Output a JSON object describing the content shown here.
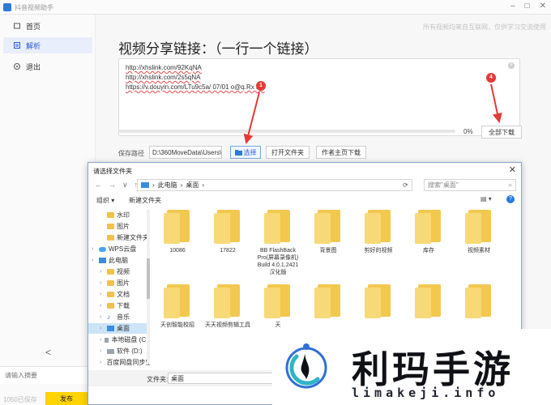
{
  "app": {
    "title": "抖音视频助手",
    "watermark": "所有视频均来自互联网，仅供学习交流使用",
    "heading": "视频分享链接：（一行一个链接）",
    "urls": [
      "http://xhslink.com/92KqNA",
      "http://xhslink.com/2s5qNA",
      "https://v.douyin.com/LTu9c5a/ 07/01 o@q.Rx mk"
    ],
    "progress": {
      "value": 0,
      "label": "0%"
    },
    "download_all": "全部下载",
    "path_label": "保存路径",
    "path_value": "D:\\360MoveData\\Users\\",
    "choose": "选择",
    "open_folder": "打开文件夹",
    "author_page": "作者主页下载"
  },
  "sidebar": {
    "items": [
      {
        "label": "首页",
        "icon": "home-icon"
      },
      {
        "label": "解析",
        "icon": "parse-icon",
        "active": true
      },
      {
        "label": "退出",
        "icon": "exit-icon"
      }
    ],
    "collapse": "<",
    "summary_placeholder": "请输入摘要",
    "counter": "1050已保存",
    "save": "发布"
  },
  "badges": {
    "choose": "1",
    "download": "4"
  },
  "dialog": {
    "title": "请选择文件夹",
    "close": "✕",
    "nav": [
      "←",
      "→",
      "∨",
      "↑"
    ],
    "breadcrumb": [
      "此电脑",
      "桌面"
    ],
    "search_placeholder": "搜索\"桌面\"",
    "organize": "组织 ▾",
    "new_folder": "新建文件夹",
    "tree": [
      {
        "label": "水印",
        "icon": "folder",
        "level": 1
      },
      {
        "label": "图片",
        "icon": "folder",
        "level": 1
      },
      {
        "label": "新建文件夹",
        "icon": "folder",
        "level": 1
      },
      {
        "label": "WPS云盘",
        "icon": "cloud",
        "level": 0
      },
      {
        "label": "此电脑",
        "icon": "pc",
        "level": 0
      },
      {
        "label": "视频",
        "icon": "folder",
        "level": 1
      },
      {
        "label": "图片",
        "icon": "folder",
        "level": 1
      },
      {
        "label": "文档",
        "icon": "folder",
        "level": 1
      },
      {
        "label": "下载",
        "icon": "folder",
        "level": 1
      },
      {
        "label": "音乐",
        "icon": "note",
        "level": 1
      },
      {
        "label": "桌面",
        "icon": "pc",
        "level": 1,
        "selected": true
      },
      {
        "label": "本地磁盘 (C:)",
        "icon": "drive",
        "level": 1
      },
      {
        "label": "软件 (D:)",
        "icon": "drive",
        "level": 1
      },
      {
        "label": "百度网盘同步空",
        "icon": "cloud",
        "level": 1
      }
    ],
    "folders": [
      "10086",
      "17822",
      "BB FlashBack Pro(屏幕录像机) Build 4.0.1.2421 汉化版",
      "背景图",
      "剪好的视频",
      "库存",
      "视频素材",
      "天创智能校招",
      "天天视频剪辑工具",
      "天",
      "",
      "",
      "",
      ""
    ],
    "folder_label": "文件夹:",
    "folder_value": "桌面"
  },
  "logo": {
    "text": "利玛手游",
    "url": "limakeji.info",
    "colors": {
      "blue": "#2f6fd6",
      "teal": "#2fb4c8",
      "dark": "#0f1116"
    }
  }
}
